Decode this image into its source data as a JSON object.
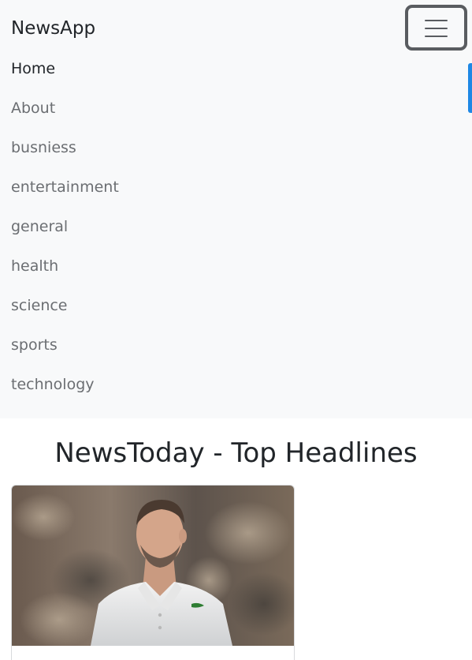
{
  "navbar": {
    "brand": "NewsApp",
    "toggler_icon": "hamburger-menu-icon",
    "items": [
      {
        "label": "Home",
        "active": true
      },
      {
        "label": "About"
      },
      {
        "label": "busniess"
      },
      {
        "label": "entertainment"
      },
      {
        "label": "general"
      },
      {
        "label": "health"
      },
      {
        "label": "science"
      },
      {
        "label": "sports"
      },
      {
        "label": "technology"
      }
    ]
  },
  "main": {
    "title": "NewsToday - Top Headlines"
  },
  "colors": {
    "navbar_bg": "#f8f9fa",
    "active_link": "#212529",
    "inactive_link": "#6b6e72",
    "accent": "#1e88e5"
  }
}
